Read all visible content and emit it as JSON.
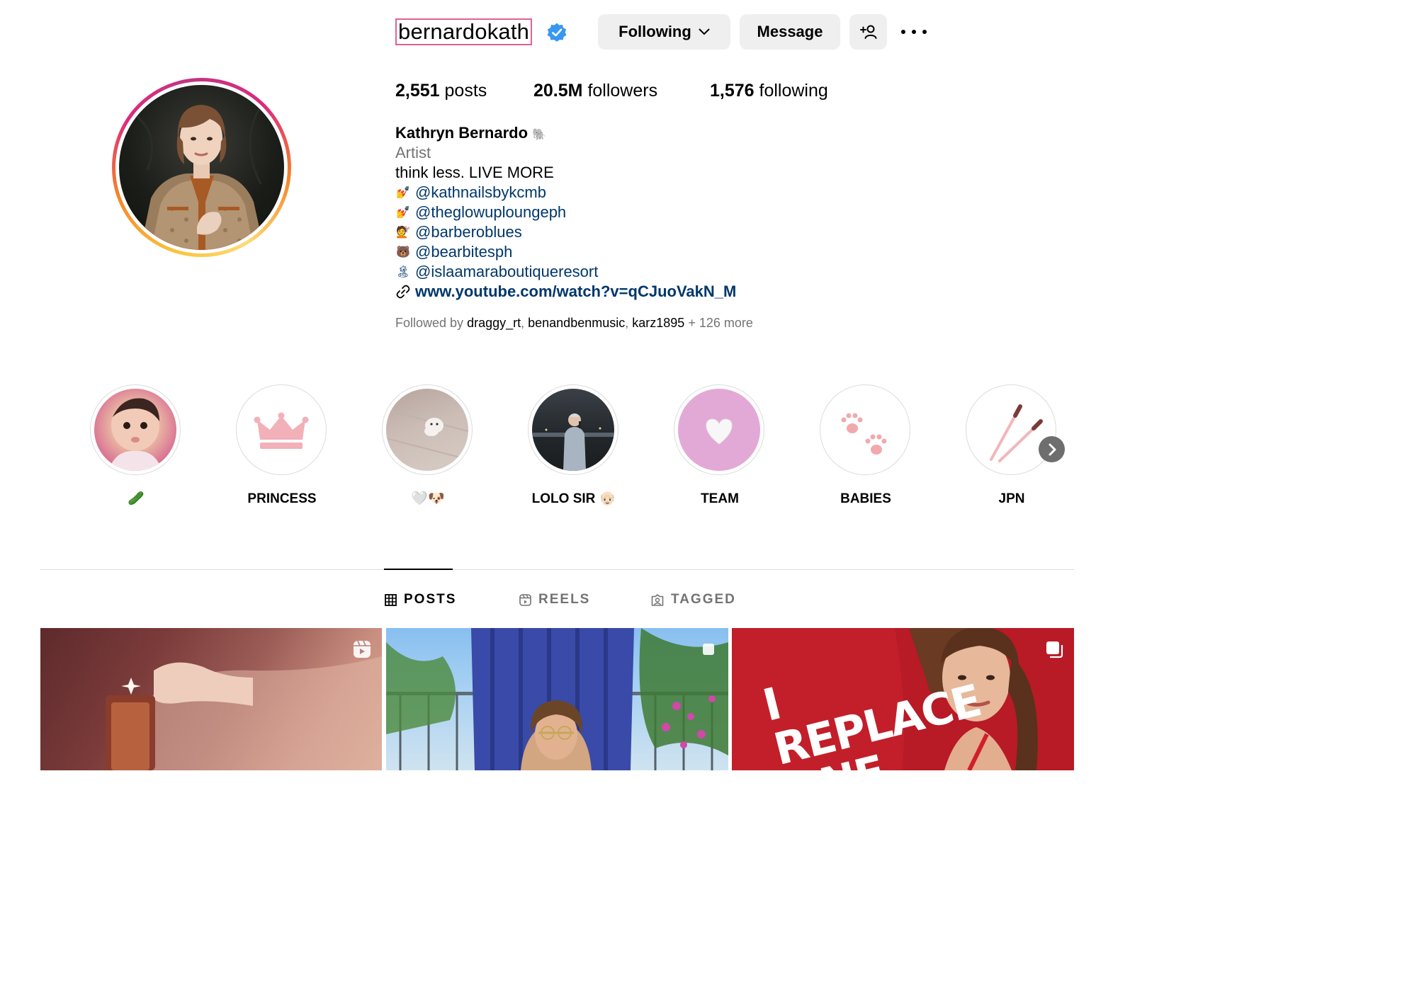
{
  "profile": {
    "username": "bernardokath",
    "verified": true,
    "buttons": {
      "following": "Following",
      "message": "Message"
    },
    "stats": {
      "posts_count": "2,551",
      "posts_label": "posts",
      "followers_count": "20.5M",
      "followers_label": "followers",
      "following_count": "1,576",
      "following_label": "following"
    },
    "bio": {
      "name": "Kathryn Bernardo",
      "name_emoji": "🐘",
      "category": "Artist",
      "text": "think less. LIVE MORE",
      "links": [
        {
          "emoji": "💅",
          "handle": "@kathnailsbykcmb"
        },
        {
          "emoji": "💅",
          "handle": "@theglowuploungeph"
        },
        {
          "emoji": "💇",
          "handle": "@barberoblues"
        },
        {
          "emoji": "🐻",
          "handle": "@bearbitesph"
        },
        {
          "emoji": "🏝",
          "handle": "@islaamaraboutiqueresort"
        }
      ],
      "url": "www.youtube.com/watch?v=qCJuoVakN_M"
    },
    "followed_by": {
      "prefix": "Followed by",
      "users": [
        "draggy_rt",
        "benandbenmusic",
        "karz1895"
      ],
      "more": "+ 126 more"
    }
  },
  "highlights": [
    {
      "label": "🥒",
      "icon": "baby-photo"
    },
    {
      "label": "PRINCESS",
      "icon": "crown-icon"
    },
    {
      "label": "🤍🐶",
      "icon": "puppy-photo"
    },
    {
      "label": "LOLO SIR 👴🏻",
      "icon": "singer-photo"
    },
    {
      "label": "TEAM",
      "icon": "white-heart-icon"
    },
    {
      "label": "BABIES",
      "icon": "paw-prints-icon"
    },
    {
      "label": "JPN",
      "icon": "chopsticks-icon"
    }
  ],
  "tabs": [
    {
      "label": "POSTS",
      "active": true,
      "icon": "grid-icon"
    },
    {
      "label": "REELS",
      "active": false,
      "icon": "reels-icon"
    },
    {
      "label": "TAGGED",
      "active": false,
      "icon": "tagged-icon"
    }
  ],
  "posts": [
    {
      "type": "reel"
    },
    {
      "type": "image"
    },
    {
      "type": "carousel",
      "overlay_text": "I REPLACE ONE"
    }
  ],
  "colors": {
    "link": "#00376b",
    "muted": "#737373",
    "button_bg": "#efefef",
    "verified": "#0095f6",
    "team_pink": "#e3a9d6",
    "post3_red": "#c21f2b"
  }
}
